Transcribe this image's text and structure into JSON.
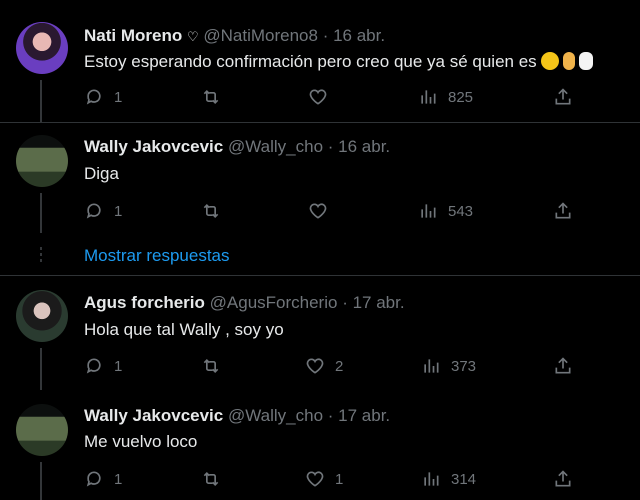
{
  "tweets": [
    {
      "name": "Nati Moreno",
      "badge": "♡",
      "handle": "@NatiMoreno8",
      "dot": "·",
      "date": "16 abr.",
      "text": "Estoy esperando confirmación pero creo que ya sé quien es",
      "emojis": [
        "face-with-tears-of-joy",
        "crossed-fingers",
        "chicken"
      ],
      "replies": "1",
      "likes": "",
      "views": "825"
    },
    {
      "name": "Wally Jakovcevic",
      "handle": "@Wally_cho",
      "dot": "·",
      "date": "16 abr.",
      "text": "Diga",
      "replies": "1",
      "likes": "",
      "views": "543"
    },
    {
      "name": "Agus forcherio",
      "handle": "@AgusForcherio",
      "dot": "·",
      "date": "17 abr.",
      "text": "Hola que tal Wally , soy yo",
      "replies": "1",
      "likes": "2",
      "views": "373"
    },
    {
      "name": "Wally Jakovcevic",
      "handle": "@Wally_cho",
      "dot": "·",
      "date": "17 abr.",
      "text": "Me vuelvo loco",
      "replies": "1",
      "likes": "1",
      "views": "314"
    }
  ],
  "show_more": "Mostrar respuestas",
  "colors": {
    "background": "#000000",
    "text": "#e7e9ea",
    "muted": "#71767b",
    "link": "#1d9bf0",
    "divider": "#2f3336"
  }
}
